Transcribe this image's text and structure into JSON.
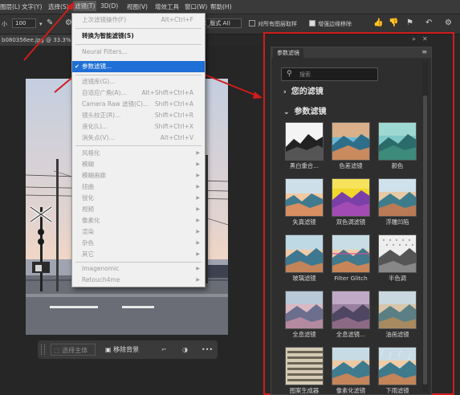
{
  "menubar": {
    "items": [
      "图层(L)",
      "文字(Y)",
      "选择(S)",
      "滤镜(T)",
      "3D(D)",
      "视图(V)",
      "增效工具",
      "窗口(W)",
      "帮助(H)"
    ]
  },
  "optbar": {
    "size_label": "小",
    "size_value": "100",
    "select_value": "(_版式 AI)",
    "checkbox1_label": "对所有图层取样",
    "checkbox2_label": "增强边缘移除"
  },
  "doc": {
    "tab_label": "b080356ee.jpg @ 33.3%"
  },
  "canvas_toolbar": {
    "select_subject": "选择主体",
    "remove_background": "移除背景",
    "more": "•••"
  },
  "filter_menu": {
    "items": [
      {
        "label": "上次滤镜操作(F)",
        "shortcut": "Alt+Ctrl+F",
        "state": "disabled"
      },
      {
        "label": "转换为智能滤镜(S)",
        "state": "bold"
      },
      {
        "label": "Neural Filters...",
        "state": "disabled"
      },
      {
        "label": "参数滤镜...",
        "state": "selected"
      },
      {
        "label": "滤镜库(G)...",
        "state": "disabled"
      },
      {
        "label": "自适应广角(A)...",
        "shortcut": "Alt+Shift+Ctrl+A",
        "state": "disabled"
      },
      {
        "label": "Camera Raw 滤镜(C)...",
        "shortcut": "Shift+Ctrl+A",
        "state": "disabled"
      },
      {
        "label": "镜头校正(R)...",
        "shortcut": "Shift+Ctrl+R",
        "state": "disabled"
      },
      {
        "label": "液化(L)...",
        "shortcut": "Shift+Ctrl+X",
        "state": "disabled"
      },
      {
        "label": "消失点(V)...",
        "shortcut": "Alt+Ctrl+V",
        "state": "disabled"
      },
      {
        "label": "风格化",
        "state": "disabled"
      },
      {
        "label": "模糊",
        "state": "disabled"
      },
      {
        "label": "模糊画廊",
        "state": "disabled"
      },
      {
        "label": "扭曲",
        "state": "disabled"
      },
      {
        "label": "锐化",
        "state": "disabled"
      },
      {
        "label": "视频",
        "state": "disabled"
      },
      {
        "label": "像素化",
        "state": "disabled"
      },
      {
        "label": "渲染",
        "state": "disabled"
      },
      {
        "label": "杂色",
        "state": "disabled"
      },
      {
        "label": "其它",
        "state": "disabled"
      },
      {
        "label": "Imagenomic",
        "state": "disabled"
      },
      {
        "label": "Retouch4me",
        "state": "disabled"
      }
    ]
  },
  "panel": {
    "tab_label": "参数滤镜",
    "search_placeholder": "搜索",
    "section_yours": "您的滤镜",
    "section_params": "参数滤镜",
    "filters": [
      "黑白重合...",
      "色差滤镜",
      "颜色",
      "失真滤镜",
      "双色调滤镜",
      "浮雕凹陷",
      "玻璃滤镜",
      "Filter Glitch",
      "半色调",
      "全息滤镜",
      "全息滤镜...",
      "油画滤镜",
      "图案生成器",
      "像素化滤镜",
      "下雨滤镜"
    ]
  },
  "colors": {
    "accent_selected": "#1f6fd6",
    "annotation_red": "#d11c1c"
  }
}
